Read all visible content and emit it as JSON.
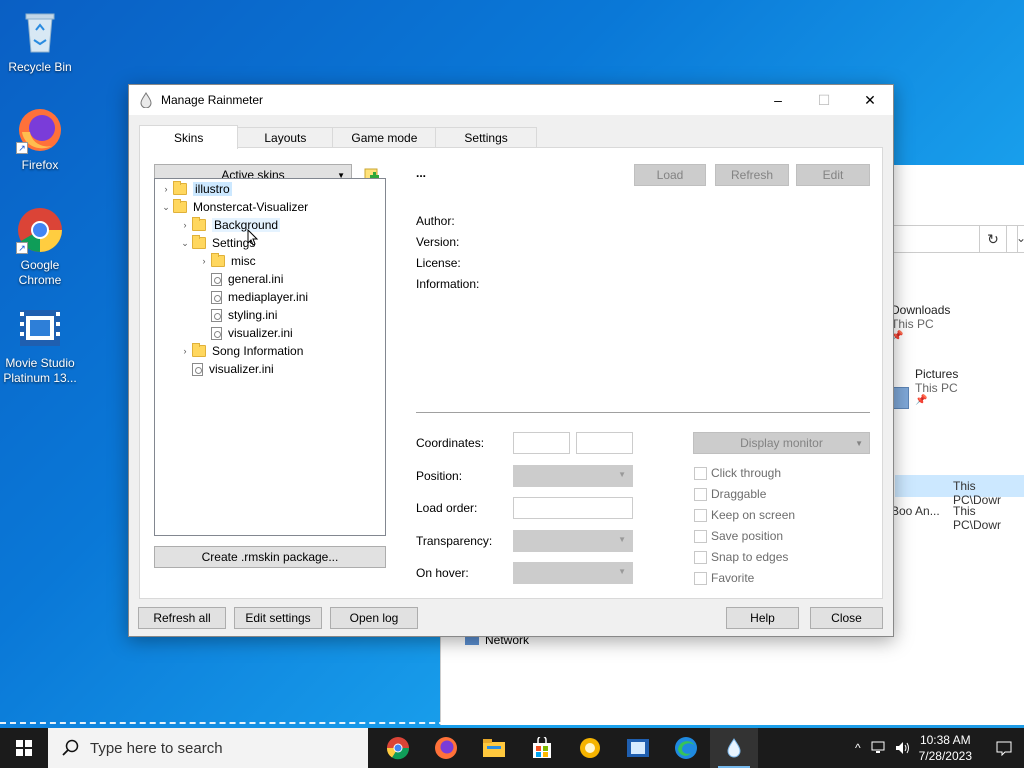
{
  "desktop": {
    "icons": [
      {
        "label": "Recycle Bin",
        "icon": "recycle-bin-icon"
      },
      {
        "label": "Firefox",
        "icon": "firefox-icon"
      },
      {
        "label": "Google Chrome",
        "icon": "chrome-icon"
      },
      {
        "label": "Movie Studio Platinum 13...",
        "icon": "movie-studio-icon"
      }
    ]
  },
  "explorer": {
    "quick_access": [
      {
        "name": "Downloads",
        "location": "This PC"
      },
      {
        "name": "Pictures",
        "location": "This PC"
      }
    ],
    "recent_paths": [
      "This PC\\Dowr",
      "This PC\\Dowr"
    ],
    "recent_file_fragment": "Boo An...",
    "network_label": "Network"
  },
  "dialog": {
    "title": "Manage Rainmeter",
    "tabs": [
      "Skins",
      "Layouts",
      "Game mode",
      "Settings"
    ],
    "active_tab": "Skins",
    "active_skins_label": "Active skins",
    "skin_name": "...",
    "actions": {
      "load": "Load",
      "refresh": "Refresh",
      "edit": "Edit"
    },
    "tree": [
      {
        "label": "illustro",
        "type": "folder",
        "expanded": false,
        "selected": true
      },
      {
        "label": "Monstercat-Visualizer",
        "type": "folder",
        "expanded": true
      },
      {
        "label": "Background",
        "type": "folder",
        "expanded": false,
        "hovered": true
      },
      {
        "label": "Settings",
        "type": "folder",
        "expanded": true
      },
      {
        "label": "misc",
        "type": "folder",
        "expanded": false
      },
      {
        "label": "general.ini",
        "type": "file"
      },
      {
        "label": "mediaplayer.ini",
        "type": "file"
      },
      {
        "label": "styling.ini",
        "type": "file"
      },
      {
        "label": "visualizer.ini",
        "type": "file"
      },
      {
        "label": "Song Information",
        "type": "folder",
        "expanded": false
      },
      {
        "label": "visualizer.ini",
        "type": "file"
      }
    ],
    "create_package": "Create .rmskin package...",
    "metadata_labels": {
      "author": "Author:",
      "version": "Version:",
      "license": "License:",
      "information": "Information:"
    },
    "fields": {
      "coordinates": "Coordinates:",
      "position": "Position:",
      "load_order": "Load order:",
      "transparency": "Transparency:",
      "on_hover": "On hover:"
    },
    "display_monitor": "Display monitor",
    "checkboxes": [
      "Click through",
      "Draggable",
      "Keep on screen",
      "Save position",
      "Snap to edges",
      "Favorite"
    ],
    "footer": {
      "refresh_all": "Refresh all",
      "edit_settings": "Edit settings",
      "open_log": "Open log",
      "help": "Help",
      "close": "Close"
    }
  },
  "taskbar": {
    "search_placeholder": "Type here to search",
    "time": "10:38 AM",
    "date": "7/28/2023"
  }
}
